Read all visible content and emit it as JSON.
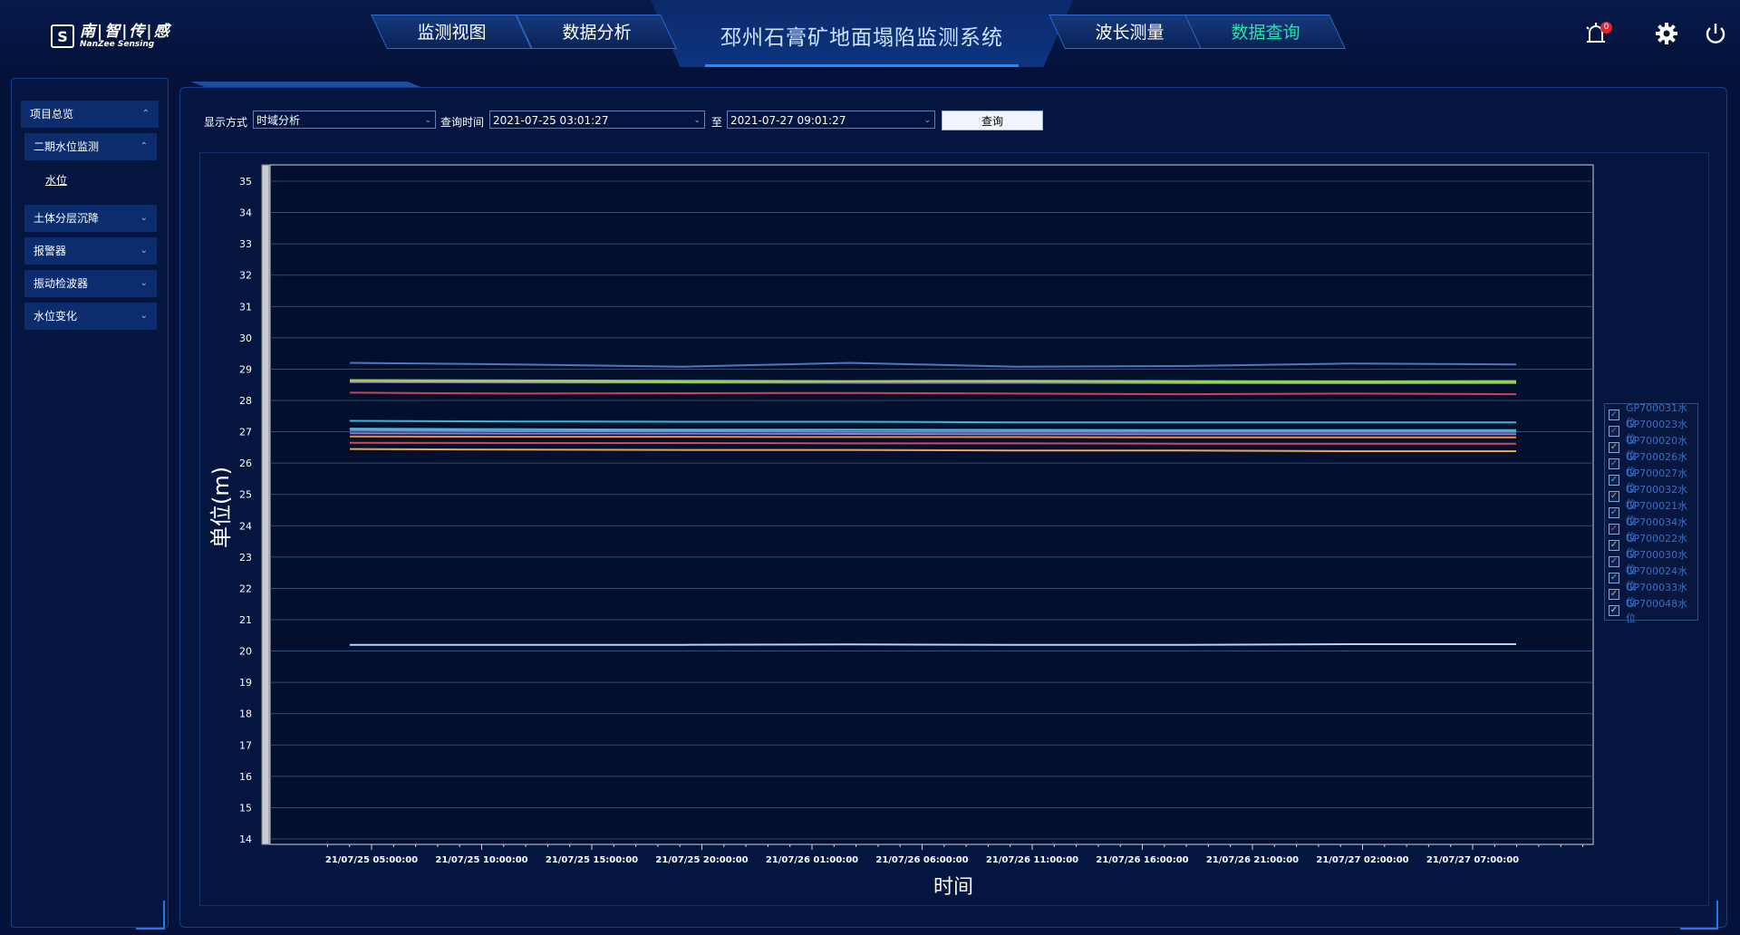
{
  "header": {
    "logo_cn": "南|智|传|感",
    "logo_en": "NanZee Sensing",
    "tabs": [
      {
        "label": "监测视图",
        "active": false
      },
      {
        "label": "数据分析",
        "active": false
      },
      {
        "label": "波长测量",
        "active": false
      },
      {
        "label": "数据查询",
        "active": true
      }
    ],
    "title": "邳州石膏矿地面塌陷监测系统",
    "alarm_count": "0",
    "icons": [
      "alarm-icon",
      "gear-icon",
      "power-icon"
    ]
  },
  "sidebar": {
    "items": [
      {
        "label": "项目总览",
        "chevron": "⌃"
      },
      {
        "label": "二期水位监测",
        "chevron": "⌃"
      },
      {
        "label": "土体分层沉降",
        "chevron": "⌄"
      },
      {
        "label": "报警器",
        "chevron": "⌄"
      },
      {
        "label": "振动检波器",
        "chevron": "⌄"
      },
      {
        "label": "水位变化",
        "chevron": "⌄"
      }
    ],
    "subitem": "水位"
  },
  "controls": {
    "mode_label": "显示方式",
    "mode_value": "时域分析",
    "time_label": "查询时间",
    "start": "2021-07-25 03:01:27",
    "to_label": "至",
    "end": "2021-07-27 09:01:27",
    "query_button": "查询"
  },
  "colors": {
    "accent": "#22e3a8",
    "background": "#04123a",
    "panel": "#041640",
    "border": "#12418c"
  },
  "chart_data": {
    "type": "line",
    "xlabel": "时间",
    "ylabel": "单位(m)",
    "ylim": [
      14,
      35
    ],
    "y_ticks": [
      14,
      15,
      16,
      17,
      18,
      19,
      20,
      21,
      22,
      23,
      24,
      25,
      26,
      27,
      28,
      29,
      30,
      31,
      32,
      33,
      34,
      35
    ],
    "x_tick_labels": [
      "21/07/25 05:00:00",
      "21/07/25 10:00:00",
      "21/07/25 15:00:00",
      "21/07/25 20:00:00",
      "21/07/26 01:00:00",
      "21/07/26 06:00:00",
      "21/07/26 11:00:00",
      "21/07/26 16:00:00",
      "21/07/26 21:00:00",
      "21/07/27 02:00:00",
      "21/07/27 07:00:00"
    ],
    "grid": true,
    "legend_position": "right",
    "series": [
      {
        "name": "GP700031水位",
        "color": "#4a78c8",
        "values": [
          29.2,
          29.15,
          29.08,
          29.2,
          29.08,
          29.1,
          29.18,
          29.15
        ]
      },
      {
        "name": "GP700023水位",
        "color": "#c8455a",
        "values": [
          28.25,
          28.22,
          28.23,
          28.24,
          28.22,
          28.2,
          28.22,
          28.2
        ]
      },
      {
        "name": "GP700020水位",
        "color": "#8ed15a",
        "values": [
          28.65,
          28.64,
          28.63,
          28.62,
          28.63,
          28.62,
          28.61,
          28.62
        ]
      },
      {
        "name": "GP700026水位",
        "color": "#8a5cc2",
        "values": [
          28.58,
          28.57,
          28.57,
          28.56,
          28.56,
          28.55,
          28.55,
          28.55
        ]
      },
      {
        "name": "GP700027水位",
        "color": "#39b7d6",
        "values": [
          27.35,
          27.33,
          27.32,
          27.32,
          27.3,
          27.3,
          27.3,
          27.3
        ]
      },
      {
        "name": "GP700032水位",
        "color": "#e8923a",
        "values": [
          26.85,
          26.84,
          26.84,
          26.83,
          26.83,
          26.82,
          26.82,
          26.82
        ]
      },
      {
        "name": "GP700021水位",
        "color": "#6f94d6",
        "values": [
          27.05,
          27.02,
          27.02,
          27.0,
          27.0,
          27.0,
          27.0,
          27.0
        ]
      },
      {
        "name": "GP700034水位",
        "color": "#d04a58",
        "values": [
          26.65,
          26.64,
          26.64,
          26.63,
          26.63,
          26.62,
          26.62,
          26.62
        ]
      },
      {
        "name": "GP700022水位",
        "color": "#9bcf5f",
        "values": [
          28.62,
          28.6,
          28.58,
          28.6,
          28.6,
          28.58,
          28.57,
          28.58
        ]
      },
      {
        "name": "GP700030水位",
        "color": "#9b7ac9",
        "values": [
          26.95,
          26.94,
          26.94,
          26.93,
          26.92,
          26.92,
          26.92,
          26.92
        ]
      },
      {
        "name": "GP700024水位",
        "color": "#4fb8dc",
        "values": [
          27.1,
          27.08,
          27.07,
          27.07,
          27.06,
          27.05,
          27.05,
          27.05
        ]
      },
      {
        "name": "GP700033水位",
        "color": "#f0a450",
        "values": [
          26.45,
          26.43,
          26.42,
          26.42,
          26.4,
          26.4,
          26.38,
          26.38
        ]
      },
      {
        "name": "GP700048水位",
        "color": "#b8cfff",
        "values": [
          20.2,
          20.2,
          20.2,
          20.21,
          20.2,
          20.2,
          20.22,
          20.22
        ]
      }
    ]
  }
}
